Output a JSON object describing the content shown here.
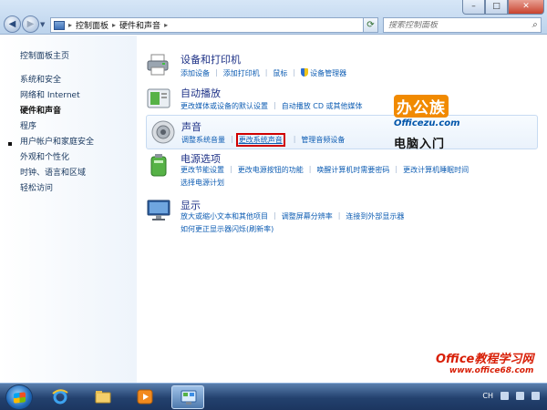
{
  "address_bar": {
    "crumbs": [
      "控制面板",
      "硬件和声音"
    ]
  },
  "search": {
    "placeholder": "搜索控制面板"
  },
  "window_buttons": {
    "minimize": "–",
    "maximize": "□",
    "close": "✕"
  },
  "sidebar": {
    "items": [
      {
        "label": "控制面板主页",
        "current": false
      },
      {
        "label": "系统和安全",
        "current": false
      },
      {
        "label": "网络和 Internet",
        "current": false
      },
      {
        "label": "硬件和声音",
        "current": true
      },
      {
        "label": "程序",
        "current": false
      },
      {
        "label": "用户帐户和家庭安全",
        "current": false
      },
      {
        "label": "外观和个性化",
        "current": false
      },
      {
        "label": "时钟、语言和区域",
        "current": false
      },
      {
        "label": "轻松访问",
        "current": false
      }
    ]
  },
  "categories": [
    {
      "title": "设备和打印机",
      "icon": "printer-icon",
      "links": [
        [
          "添加设备",
          "添加打印机",
          "鼠标",
          "设备管理器"
        ]
      ]
    },
    {
      "title": "自动播放",
      "icon": "autoplay-icon",
      "links": [
        [
          "更改媒体或设备的默认设置",
          "自动播放 CD 或其他媒体"
        ]
      ]
    },
    {
      "title": "声音",
      "icon": "speaker-icon",
      "highlighted": true,
      "links": [
        [
          "调整系统音量",
          "更改系统声音",
          "管理音频设备"
        ]
      ],
      "boxed_link": "更改系统声音"
    },
    {
      "title": "电源选项",
      "icon": "battery-icon",
      "links": [
        [
          "更改节能设置",
          "更改电源按钮的功能",
          "唤醒计算机时需要密码",
          "更改计算机睡眠时间"
        ],
        [
          "选择电源计划"
        ]
      ]
    },
    {
      "title": "显示",
      "icon": "monitor-icon",
      "links": [
        [
          "放大或缩小文本和其他项目",
          "调整屏幕分辨率",
          "连接到外部显示器"
        ],
        [
          "如何更正显示器闪烁(刷新率)"
        ]
      ]
    }
  ],
  "watermarks": {
    "logo_main": "办公族",
    "logo_site": "Officezu.com",
    "logo_sub": "电脑入门",
    "bottom_title": "Office教程学习网",
    "bottom_url": "www.office68.com"
  },
  "taskbar": {
    "apps": [
      "ie-icon",
      "explorer-icon",
      "media-player-icon",
      "control-panel-icon"
    ],
    "tray_lang": "CH"
  },
  "colors": {
    "link": "#0e5db3",
    "title": "#1e3287",
    "highlight_box": "#d00000"
  }
}
